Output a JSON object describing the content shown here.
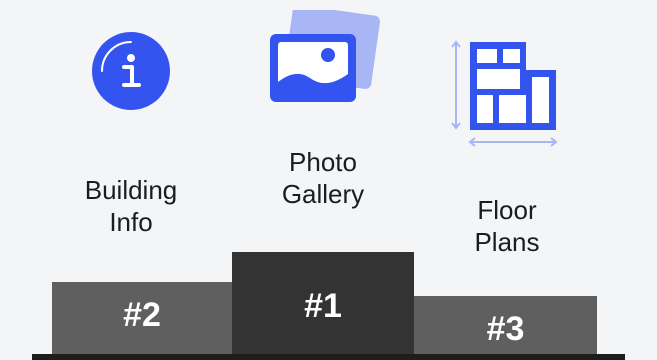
{
  "colors": {
    "background": "#f4f5f7",
    "icon_blue": "#3454f0",
    "icon_blue_light": "#a9b6f6",
    "text": "#1b1c1f",
    "podium_first": "#333333",
    "podium_side": "#5f5f5f",
    "baseline": "#1d1d1d"
  },
  "podium": {
    "first": {
      "label_lines": [
        "Photo",
        "Gallery"
      ],
      "rank": "#1",
      "icon": "photo-gallery-icon"
    },
    "second": {
      "label_lines": [
        "Building",
        "Info"
      ],
      "rank": "#2",
      "icon": "info-icon"
    },
    "third": {
      "label_lines": [
        "Floor",
        "Plans"
      ],
      "rank": "#3",
      "icon": "floor-plan-icon"
    }
  }
}
